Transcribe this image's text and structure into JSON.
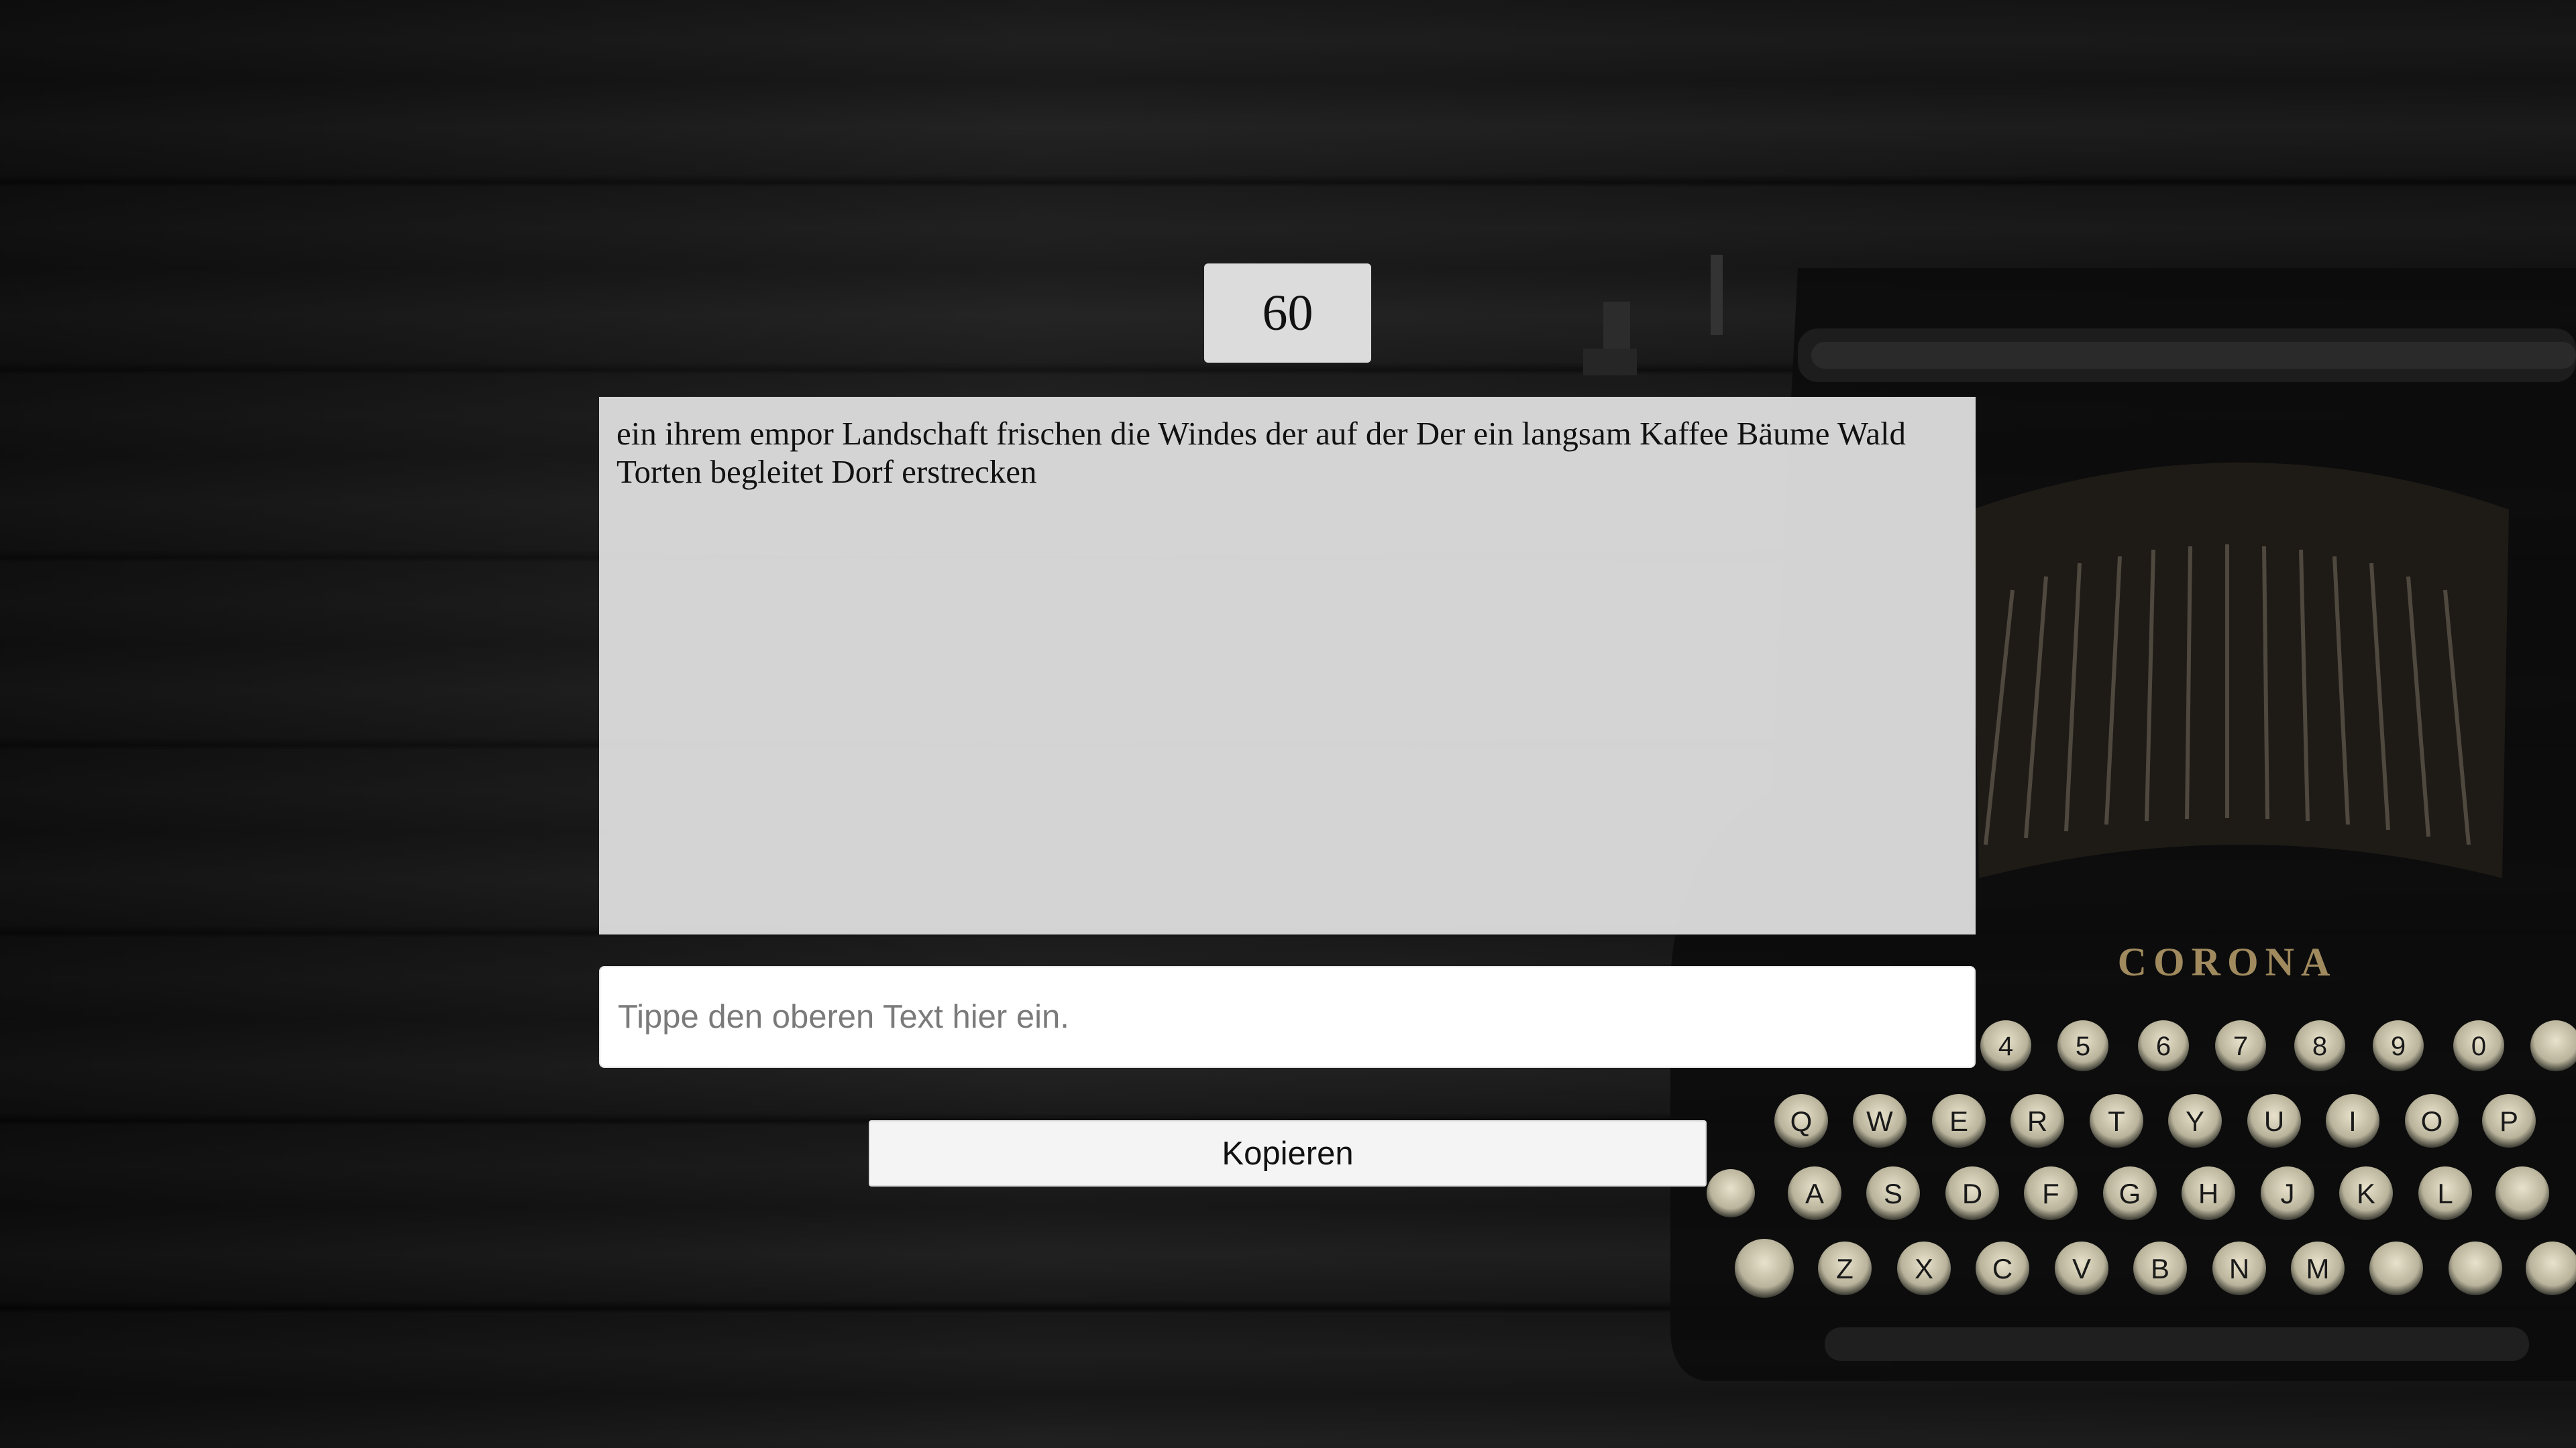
{
  "timer": {
    "value": "60"
  },
  "source_text": {
    "content": "ein ihrem empor Landschaft frischen die Windes der auf der Der ein langsam Kaffee Bäume Wald Torten begleitet Dorf erstrecken"
  },
  "typing_input": {
    "value": "",
    "placeholder": "Tippe den oberen Text hier ein."
  },
  "copy_button": {
    "label": "Kopieren"
  },
  "typewriter": {
    "brand": "CORONA",
    "number_row": [
      "4",
      "5",
      "6",
      "7",
      "8",
      "9",
      "0"
    ],
    "row_q": [
      "Q",
      "W",
      "E",
      "R",
      "T",
      "Y",
      "U",
      "I",
      "O",
      "P"
    ],
    "row_a": [
      "A",
      "S",
      "D",
      "F",
      "G",
      "H",
      "J",
      "K",
      "L"
    ],
    "row_z": [
      "Z",
      "X",
      "C",
      "V",
      "B",
      "N",
      "M"
    ]
  },
  "colors": {
    "background": "#141414",
    "text_box": "#dcdcdc",
    "input_bg": "#ffffff",
    "button_bg": "#f4f4f4"
  }
}
